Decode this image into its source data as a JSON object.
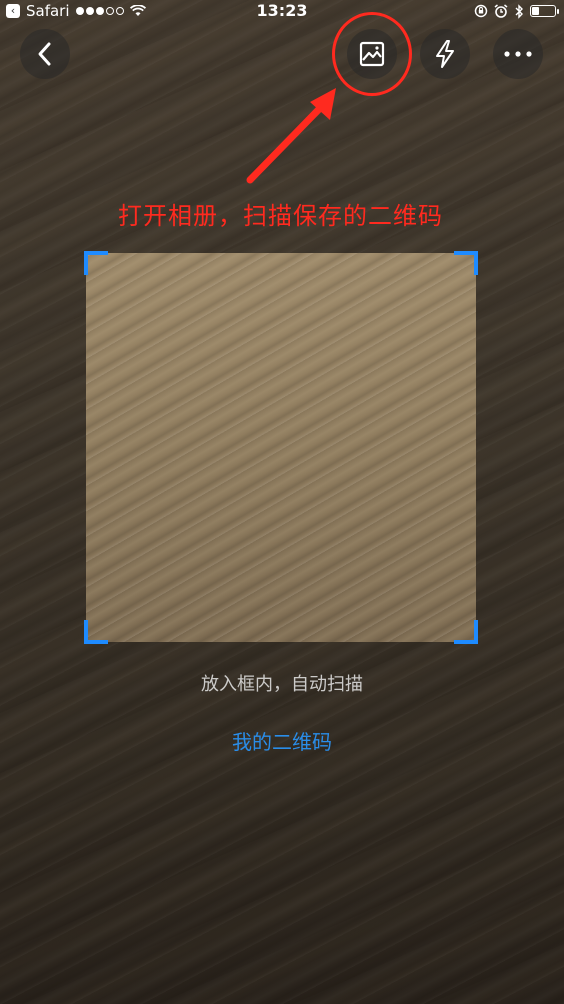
{
  "status_bar": {
    "app_name": "Safari",
    "time": "13:23",
    "battery_level": 0.3,
    "icons": [
      "signal-dots-icon",
      "wifi-icon",
      "orientation-lock-icon",
      "alarm-icon",
      "bluetooth-icon",
      "battery-icon"
    ]
  },
  "toolbar": {
    "back_icon": "chevron-left-icon",
    "album_icon": "image-icon",
    "flash_icon": "lightning-icon",
    "more_icon": "ellipsis-icon"
  },
  "annotation": {
    "text": "打开相册，扫描保存的二维码",
    "color": "#ff2a1f"
  },
  "scanner": {
    "corner_color": "#1e8bff",
    "hint": "放入框内，自动扫描",
    "my_qr_link": "我的二维码",
    "link_color": "#2a8de8"
  }
}
